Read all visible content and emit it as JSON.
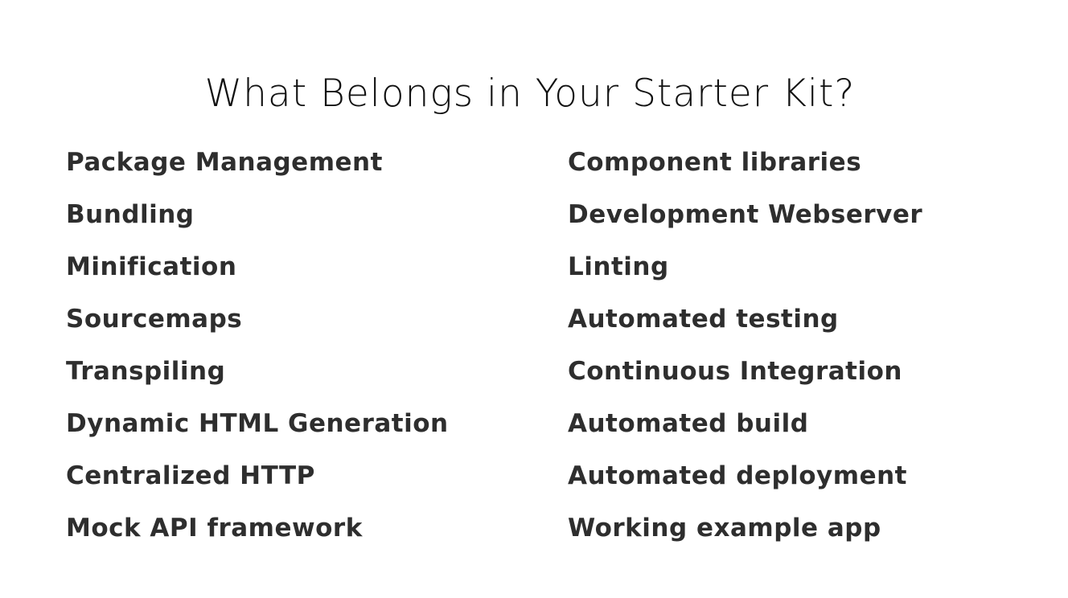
{
  "slide": {
    "title": "What Belongs in Your Starter Kit?",
    "left_items": [
      "Package Management",
      "Bundling",
      "Minification",
      "Sourcemaps",
      "Transpiling",
      "Dynamic HTML Generation",
      "Centralized HTTP",
      "Mock API framework"
    ],
    "right_items": [
      "Component libraries",
      "Development Webserver",
      "Linting",
      "Automated testing",
      "Continuous Integration",
      "Automated build",
      "Automated deployment",
      "Working example app"
    ]
  },
  "colors": {
    "background": "#ffffff",
    "title": "#111111",
    "item_text": "#2e2e2e"
  }
}
